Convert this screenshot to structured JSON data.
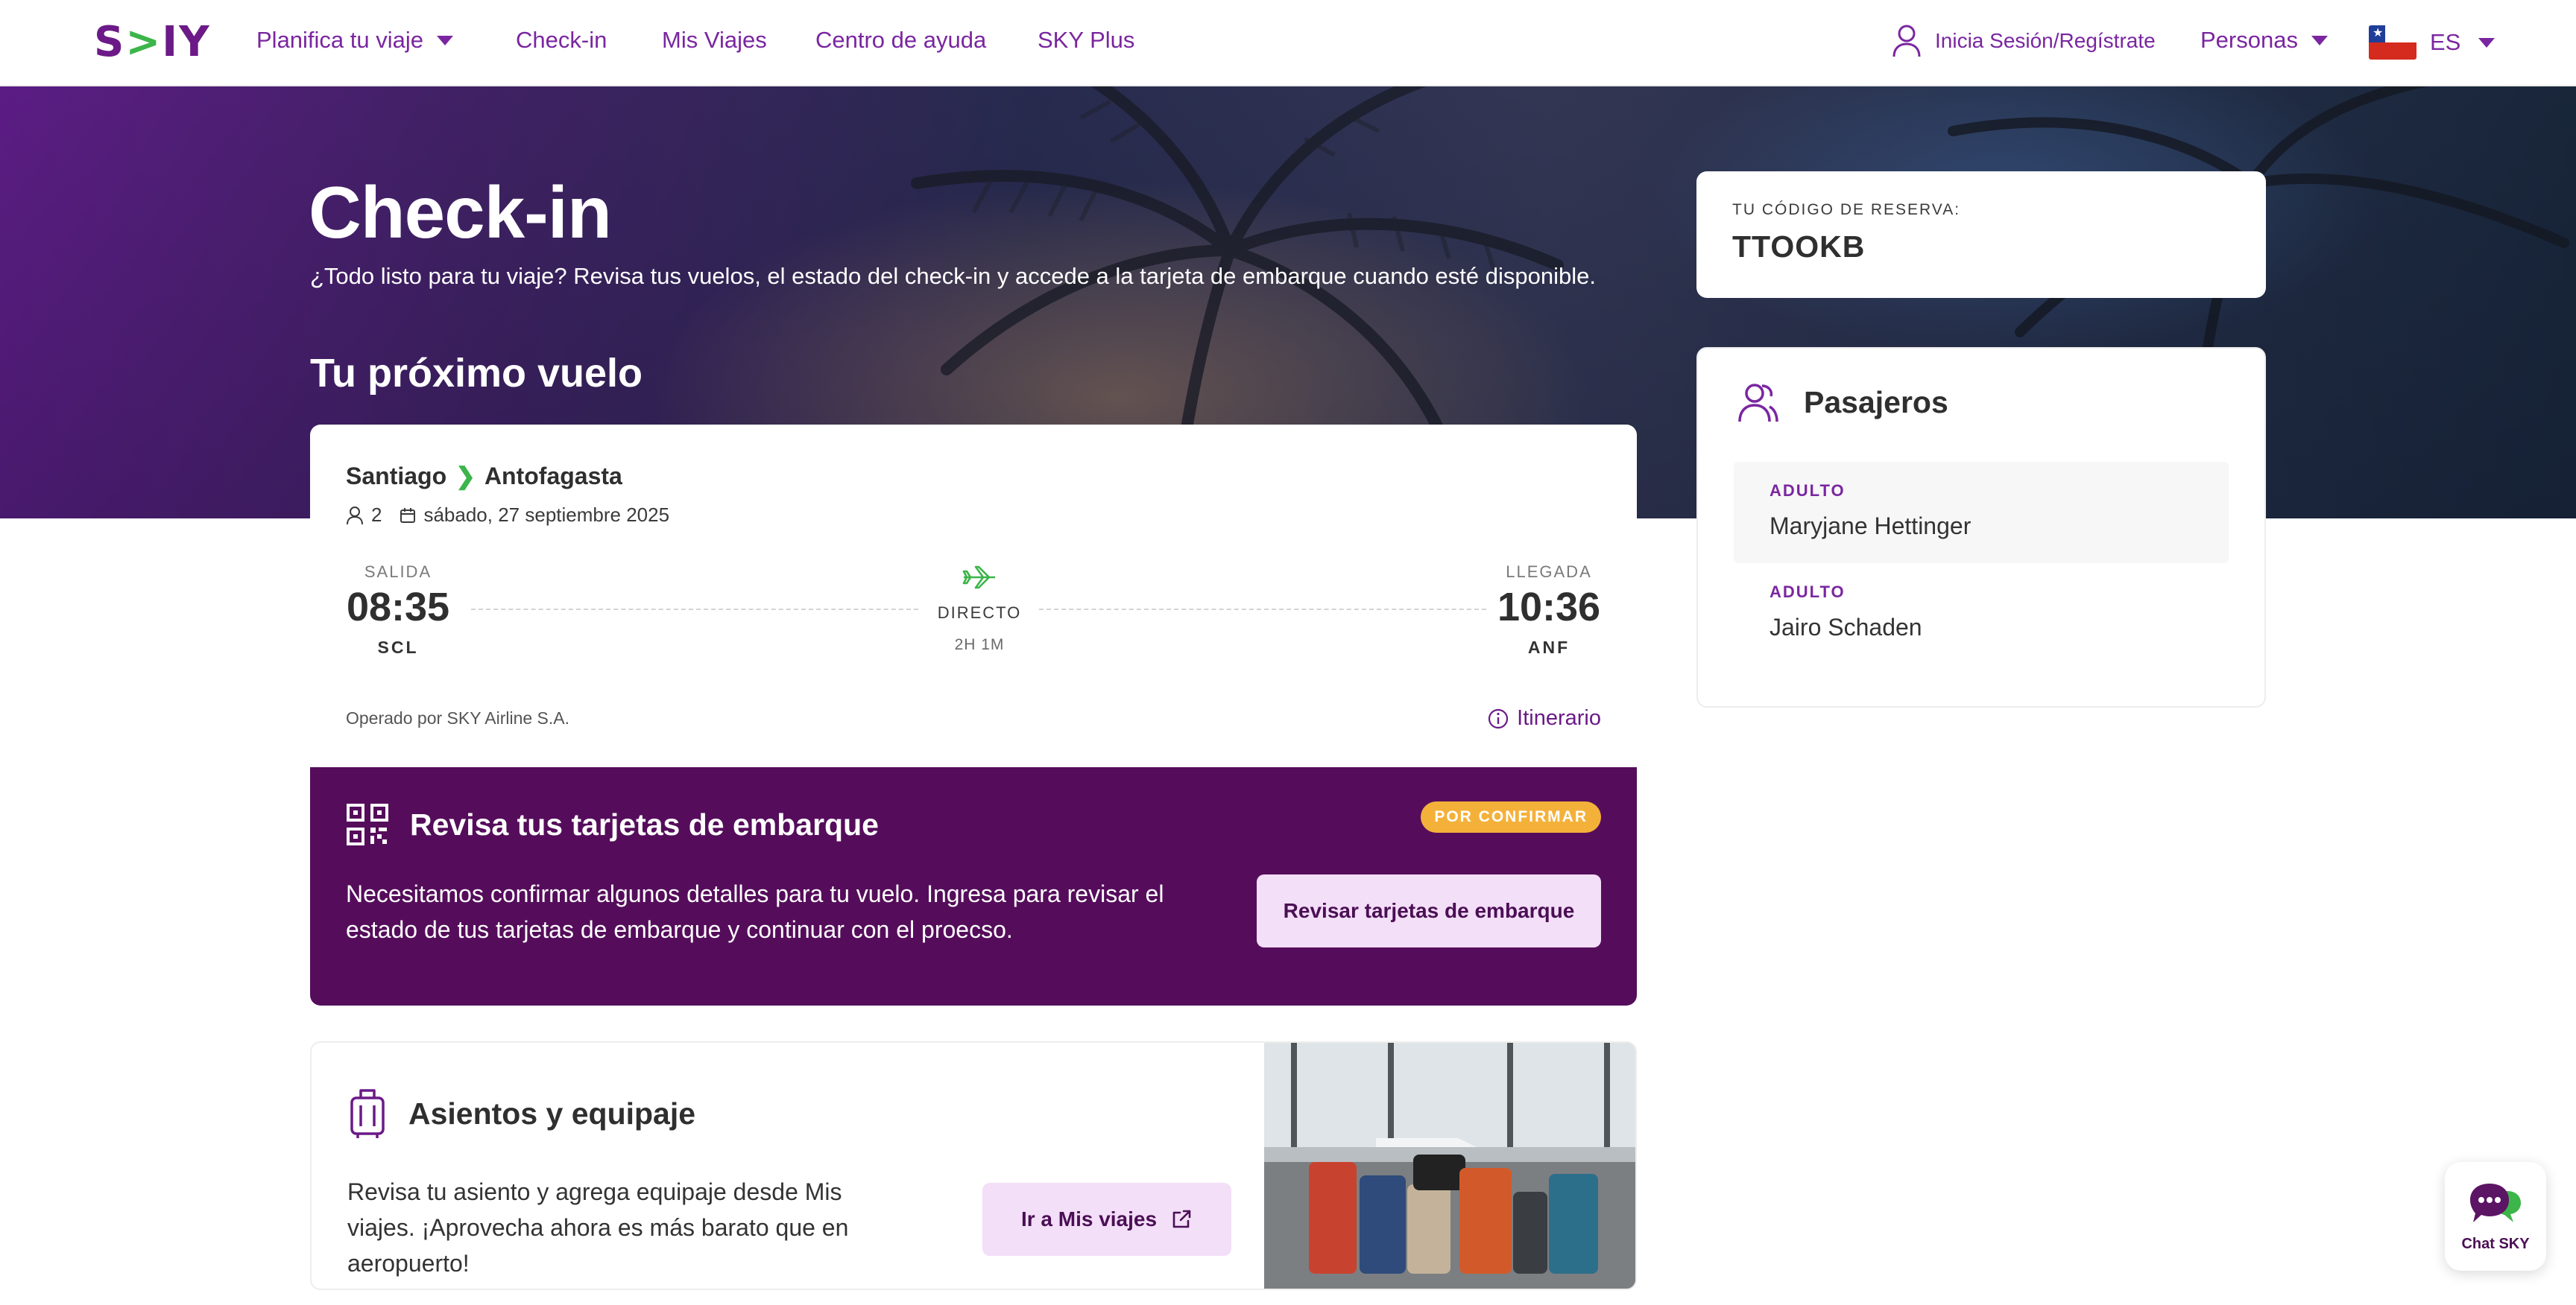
{
  "nav": {
    "logo": "SKY",
    "plan_trip": "Planifica tu viaje",
    "checkin": "Check-in",
    "my_trips": "Mis Viajes",
    "help_center": "Centro de ayuda",
    "sky_plus": "SKY Plus",
    "login": "Inicia Sesión/Regístrate",
    "persons": "Personas",
    "language": "ES"
  },
  "hero": {
    "title": "Check-in",
    "subtitle": "¿Todo listo para tu viaje? Revisa tus vuelos, el estado del check-in y accede a la tarjeta de embarque cuando esté disponible.",
    "next_flight": "Tu próximo vuelo"
  },
  "reservation": {
    "label": "TU CÓDIGO DE RESERVA:",
    "code": "TTOOKB"
  },
  "passengers": {
    "title": "Pasajeros",
    "list": [
      {
        "type": "ADULTO",
        "name": "Maryjane Hettinger"
      },
      {
        "type": "ADULTO",
        "name": "Jairo Schaden"
      }
    ]
  },
  "flight": {
    "origin": "Santiago",
    "destination": "Antofagasta",
    "pax_count": "2",
    "date": "sábado, 27 septiembre 2025",
    "departure": {
      "label": "SALIDA",
      "time": "08:35",
      "code": "SCL"
    },
    "arrival": {
      "label": "LLEGADA",
      "time": "10:36",
      "code": "ANF"
    },
    "type": "DIRECTO",
    "duration": "2H 1M",
    "operated_by": "Operado por SKY Airline S.A.",
    "itinerary": "Itinerario"
  },
  "boarding": {
    "title": "Revisa tus tarjetas de embarque",
    "badge": "POR CONFIRMAR",
    "text": "Necesitamos confirmar algunos detalles para tu vuelo. Ingresa para revisar el estado de tus tarjetas de embarque y continuar con el proecso.",
    "button": "Revisar tarjetas de embarque"
  },
  "seats": {
    "title": "Asientos y equipaje",
    "text": "Revisa tu asiento y agrega equipaje desde Mis viajes. ¡Aprovecha ahora es más barato que en aeropuerto!",
    "button": "Ir a Mis viajes"
  },
  "chat": {
    "label": "Chat SKY"
  },
  "colors": {
    "brand_purple": "#6b1a87",
    "deep_purple": "#550d5b",
    "accent_green": "#3cb54a",
    "badge_orange": "#f4b13a",
    "button_light": "#f3dff8"
  },
  "icons": [
    "user-icon",
    "flag-chile-icon",
    "person-icon",
    "calendar-icon",
    "plane-icon",
    "info-icon",
    "qr-code-icon",
    "passengers-icon",
    "luggage-icon",
    "external-link-icon",
    "chat-icon"
  ]
}
